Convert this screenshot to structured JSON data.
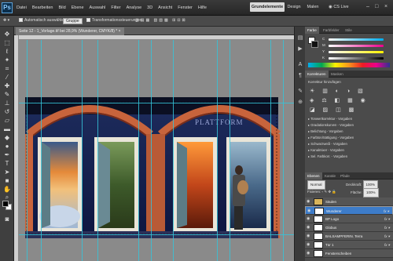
{
  "menubar": {
    "logo": "Ps",
    "menus": [
      "Datei",
      "Bearbeiten",
      "Bild",
      "Ebene",
      "Auswahl",
      "Filter",
      "Analyse",
      "3D",
      "Ansicht",
      "Fenster",
      "Hilfe"
    ],
    "zoom_value": "28,9",
    "workspaces": {
      "active": "Grundelemente",
      "second": "Design",
      "third": "Malen"
    },
    "cslive": "CS Live"
  },
  "options": {
    "auto_select_label": "Automatisch auswählen:",
    "auto_select_value": "Gruppe",
    "transform_label": "Transformationssteuerungen"
  },
  "document": {
    "tab_title": "Seite 12 - 1_Vorlage.tif bei 28,9% (Wunderer, CMYK/8) *"
  },
  "panels": {
    "color": {
      "tabs": [
        "Farbe",
        "Farbfelder",
        "Stile"
      ],
      "channels": [
        "C",
        "M",
        "Y",
        "K"
      ]
    },
    "adjustments": {
      "tabs": [
        "Korrekturen",
        "Masken"
      ],
      "header": "Korrektur hinzufügen",
      "presets": [
        "Tonwertkorrektur - Vorgaben",
        "Gradationskurven - Vorgaben",
        "Belichtung - Vorgaben",
        "Farbton/Sättigung - Vorgaben",
        "Schwarzweiß - Vorgaben",
        "Kanalmixer - Vorgaben",
        "Sel. Farbkorr. - Vorgaben"
      ]
    },
    "layers": {
      "tabs": [
        "Ebenen",
        "Kanäle",
        "Pfade"
      ],
      "blend_mode": "Normal",
      "opacity_label": "Deckkraft:",
      "opacity_value": "100%",
      "fill_label": "Fläche:",
      "fill_value": "100%",
      "lock_label": "Fixieren:",
      "items": [
        {
          "name": "Säulen",
          "fx": false
        },
        {
          "name": "Wunderer",
          "fx": true
        },
        {
          "name": "BP Logo",
          "fx": true
        },
        {
          "name": "Globus",
          "fx": true
        },
        {
          "name": "BALSAMPFERIN. Terra",
          "fx": true
        },
        {
          "name": "Tür 1",
          "fx": true
        },
        {
          "name": "Fensterscheiben",
          "fx": false
        }
      ]
    }
  },
  "canvas": {
    "signage": "PLATTFORM"
  },
  "colors": {
    "workspace_bg": "#535353",
    "canvas_bg": "#8a8a8a",
    "guide": "#35c3d8",
    "selected_layer": "#3d7cc9"
  },
  "icons": [
    "move-icon",
    "marquee-icon",
    "lasso-icon",
    "magic-wand-icon",
    "crop-icon",
    "eyedropper-icon",
    "healing-brush-icon",
    "brush-icon",
    "stamp-icon",
    "history-brush-icon",
    "eraser-icon",
    "gradient-icon",
    "blur-icon",
    "dodge-icon",
    "pen-icon",
    "type-icon",
    "path-select-icon",
    "shape-icon",
    "3d-rotate-icon",
    "3d-orbit-icon",
    "hand-icon",
    "zoom-icon"
  ]
}
